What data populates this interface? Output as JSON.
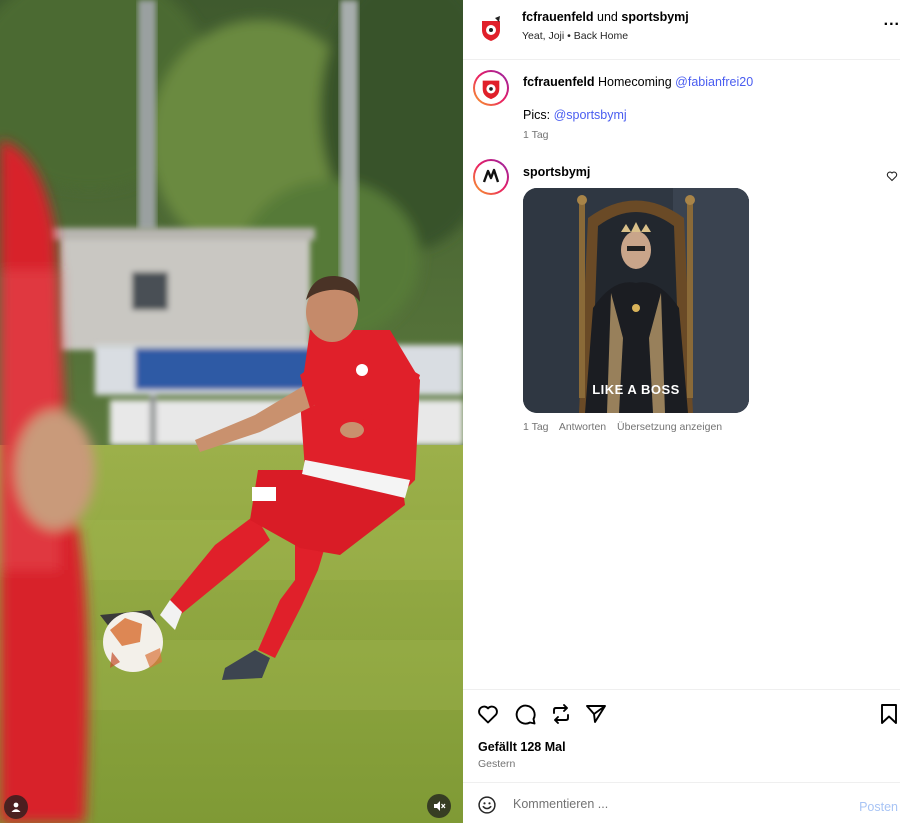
{
  "header": {
    "account_1": "fcfrauenfeld",
    "conjunction": "und",
    "account_2": "sportsbymj",
    "audio_artist": "Yeat, Joji",
    "audio_sep": "•",
    "audio_track": "Back Home",
    "more_label": "..."
  },
  "caption": {
    "username": "fcfrauenfeld",
    "text": "Homecoming",
    "mention": "@fabianfrei20",
    "pics_label": "Pics:",
    "pics_mention": "@sportsbymj",
    "time": "1 Tag"
  },
  "comment": {
    "username": "sportsbymj",
    "gif_text": "LIKE A BOSS",
    "time": "1 Tag",
    "reply": "Antworten",
    "translate": "Übersetzung anzeigen"
  },
  "actions": {
    "icons": [
      "heart-icon",
      "comment-icon",
      "share-icon",
      "send-icon",
      "bookmark-icon"
    ],
    "likes": "Gefällt 128 Mal",
    "date": "Gestern"
  },
  "comment_box": {
    "placeholder": "Kommentieren ...",
    "post_label": "Posten"
  },
  "colors": {
    "link": "#4a5df0",
    "post_button": "#a8c4f5",
    "jersey_red": "#e0202a"
  }
}
